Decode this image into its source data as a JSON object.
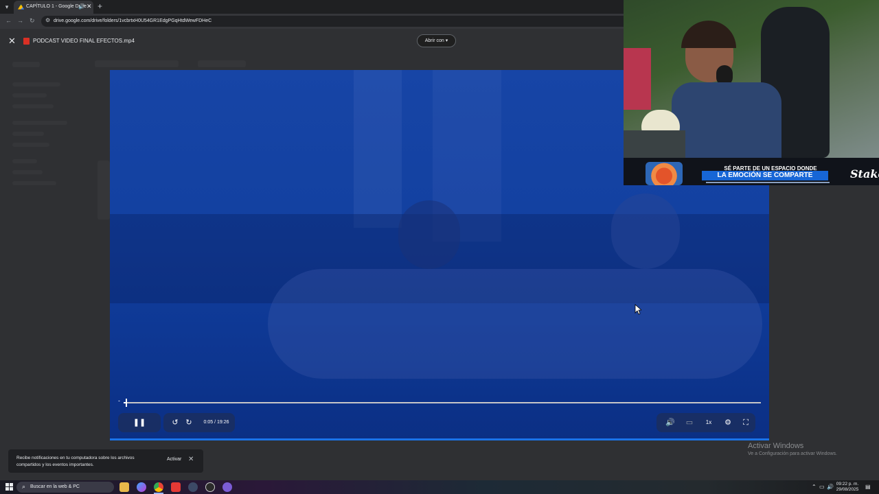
{
  "browser": {
    "tab_title": "CAPÍTULO 1 - Google Drive",
    "url": "drive.google.com/drive/folders/1vcbrtxH0U54GR1EdgPGqHtdWewFDHeC"
  },
  "viewer": {
    "file_name": "PODCAST VIDEO FINAL EFECTOS.mp4",
    "open_with_label": "Abrir con"
  },
  "video": {
    "progress_fraction": 0.004,
    "time_display": "0:05 / 19:26",
    "speed_label": "1x"
  },
  "stream_overlay": {
    "banner_line1": "SÉ PARTE DE UN ESPACIO DONDE",
    "banner_line2": "LA EMOCIÓN SE COMPARTE",
    "brand": "Stake"
  },
  "toast": {
    "message": "Recibe notificaciones en tu computadora sobre los archivos compartidos y los eventos importantes.",
    "action_label": "Activar"
  },
  "watermark": {
    "title": "Activar Windows",
    "subtitle": "Ve a Configuración para activar Windows."
  },
  "taskbar": {
    "search_placeholder": "Buscar en la web & PC",
    "time": "09:22 p. m.",
    "date": "29/08/2025"
  },
  "colors": {
    "accent": "#1a73e8",
    "video_blue": "#1240a0",
    "chrome_dark": "#35363a"
  }
}
